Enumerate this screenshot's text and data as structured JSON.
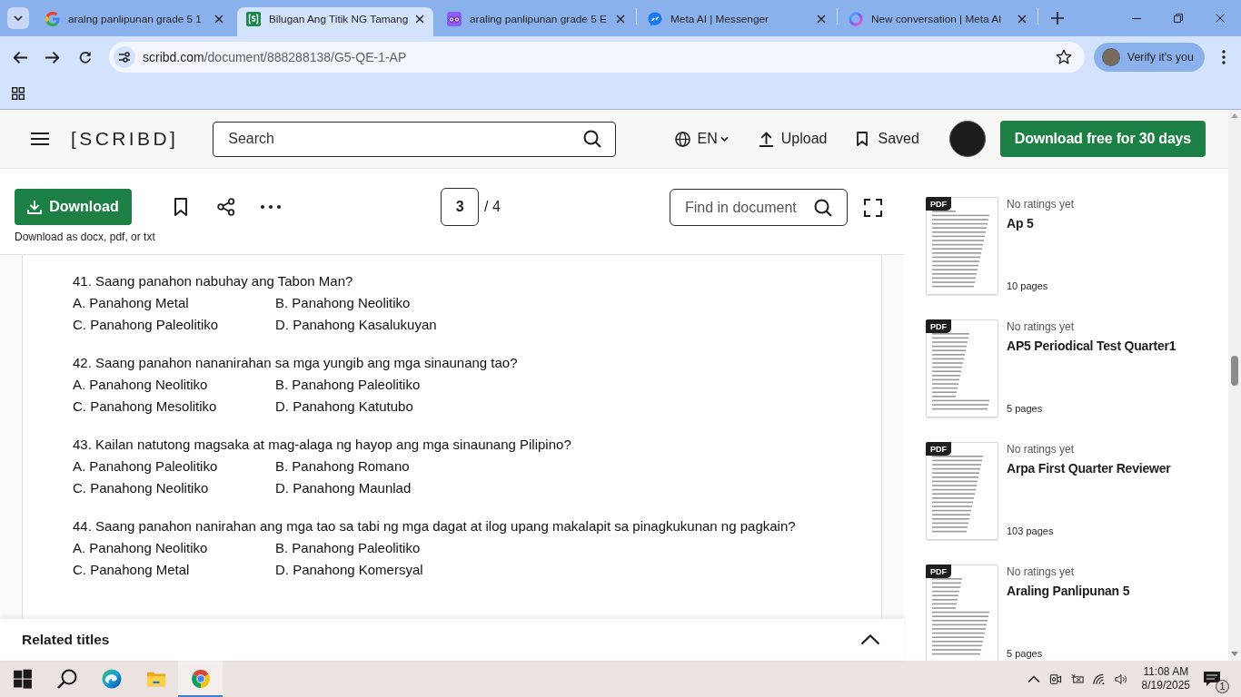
{
  "browser": {
    "tabs": [
      {
        "kind": "g",
        "title": "aralng panlipunan grade 5 1",
        "selected": false
      },
      {
        "kind": "doc",
        "title": "Bilugan Ang Titik NG Tamang",
        "selected": true
      },
      {
        "kind": "owl",
        "title": "araling panlipunan grade 5 E",
        "selected": false
      },
      {
        "kind": "chat",
        "title": "Meta AI | Messenger",
        "selected": false
      },
      {
        "kind": "ring",
        "title": "New conversation | Meta AI",
        "selected": false
      }
    ],
    "url": {
      "host": "scribd.com",
      "path": "/document/888288138/G5-QE-1-AP"
    },
    "profile_button": "Verify it's you"
  },
  "header": {
    "logo": "[SCRIBD]",
    "search": {
      "placeholder": "Search"
    },
    "language": "EN",
    "upload": "Upload",
    "saved": "Saved",
    "cta": "Download free for 30 days"
  },
  "toolbar": {
    "download": "Download",
    "download_note": "Download as docx, pdf, or txt",
    "page": {
      "value": "3",
      "total": "/ 4"
    },
    "find": {
      "placeholder": "Find in document"
    }
  },
  "questions": [
    {
      "text": "41. Saang panahon nabuhay ang Tabon Man?",
      "options": [
        "A. Panahong Metal",
        "B. Panahong Neolitiko",
        "C. Panahong Paleolitiko",
        "D. Panahong Kasalukuyan"
      ]
    },
    {
      "text": "42. Saang panahon nananirahan sa mga yungib ang mga sinaunang tao?",
      "options": [
        "A. Panahong Neolitiko",
        "B. Panahong Paleolitiko",
        "C. Panahong Mesolitiko",
        "D. Panahong Katutubo"
      ]
    },
    {
      "text": "43. Kailan natutong magsaka at mag-alaga ng hayop ang mga sinaunang Pilipino?",
      "options": [
        "A. Panahong Paleolitiko",
        "B. Panahong Romano",
        "C. Panahong Neolitiko",
        "D. Panahong Maunlad"
      ]
    },
    {
      "text": "44. Saang panahon nanirahan ang mga tao sa tabi ng mga dagat at ilog upang makalapit sa pinagkukunan ng pagkain?",
      "options": [
        "A. Panahong Neolitiko",
        "B. Panahong Paleolitiko",
        "C. Panahong Metal",
        "D. Panahong Komersyal"
      ]
    }
  ],
  "related": {
    "title": "Related titles",
    "expanded": false
  },
  "sidebar": {
    "items": [
      {
        "badge": "PDF",
        "rating": "No ratings yet",
        "title": "Ap 5",
        "pages": "10 pages"
      },
      {
        "badge": "PDF",
        "rating": "No ratings yet",
        "title": "AP5 Periodical Test Quarter1",
        "pages": "5 pages"
      },
      {
        "badge": "PDF",
        "rating": "No ratings yet",
        "title": "Arpa First Quarter Reviewer",
        "pages": "103 pages"
      },
      {
        "badge": "PDF",
        "rating": "No ratings yet",
        "title": "Araling Panlipunan 5",
        "pages": "5 pages"
      }
    ]
  },
  "taskbar": {
    "apps": [
      {
        "kind": "start",
        "active": false
      },
      {
        "kind": "search",
        "active": false
      },
      {
        "kind": "edge",
        "active": false
      },
      {
        "kind": "files",
        "active": false
      },
      {
        "kind": "chrome",
        "active": true
      }
    ],
    "time": "11:08 AM",
    "date": "8/19/2025",
    "notifications": "1"
  }
}
